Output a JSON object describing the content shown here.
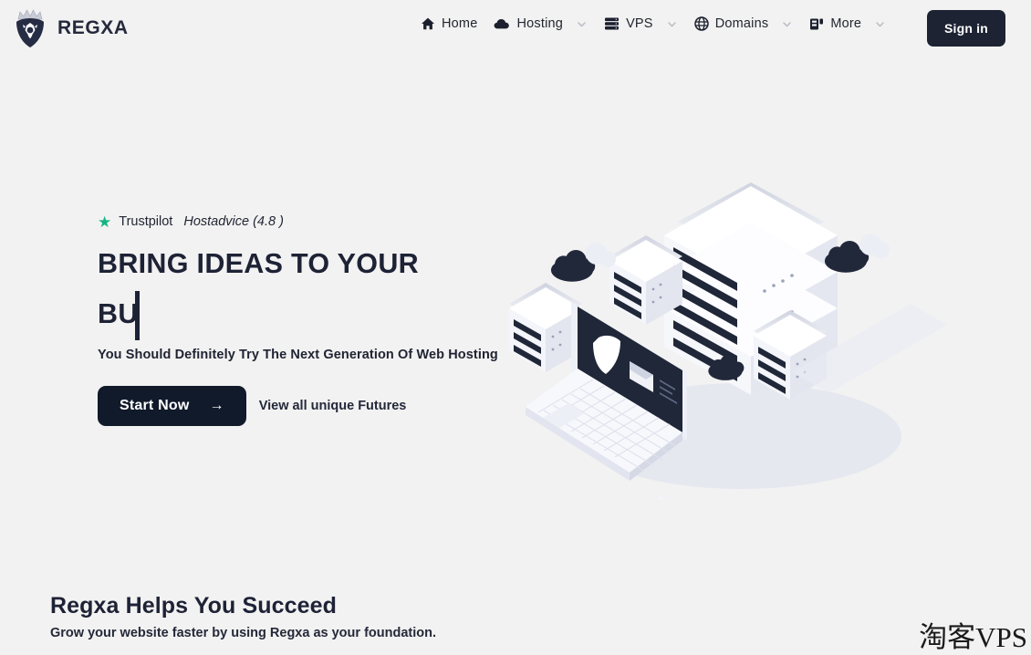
{
  "header": {
    "brand": {
      "name": "REGXA",
      "logo_icon": "lion-crown-logo"
    },
    "nav": [
      {
        "label": "Home",
        "icon": "home-icon",
        "has_chevron": false
      },
      {
        "label": "Hosting",
        "icon": "cloud-icon",
        "has_chevron": true
      },
      {
        "label": "VPS",
        "icon": "server-icon",
        "has_chevron": true
      },
      {
        "label": "Domains",
        "icon": "globe-icon",
        "has_chevron": true
      },
      {
        "label": "More",
        "icon": "grid-box-icon",
        "has_chevron": true
      }
    ],
    "signin_label": "Sign in"
  },
  "hero": {
    "rating": {
      "star_icon": "star-icon",
      "star_color": "#13b583",
      "trustpilot": "Trustpilot",
      "hostadvice": "Hostadvice (4.8 )"
    },
    "headline_line1": "BRING IDEAS TO YOUR",
    "headline_typed": "BU",
    "subline": "You Should Definitely Try The Next Generation Of Web Hosting",
    "cta_primary": "Start Now",
    "cta_primary_arrow": "→",
    "cta_secondary": "View all unique Futures",
    "illustration": "isometric-servers-laptop-clouds"
  },
  "succeed": {
    "title": "Regxa Helps You Succeed",
    "subtitle": "Grow your website faster by using Regxa as your foundation."
  },
  "watermark": {
    "text": "淘客VPS"
  },
  "colors": {
    "background": "#f2f2f2",
    "dark": "#1d2333",
    "accent_green": "#13b583",
    "text": "#1e2235"
  }
}
